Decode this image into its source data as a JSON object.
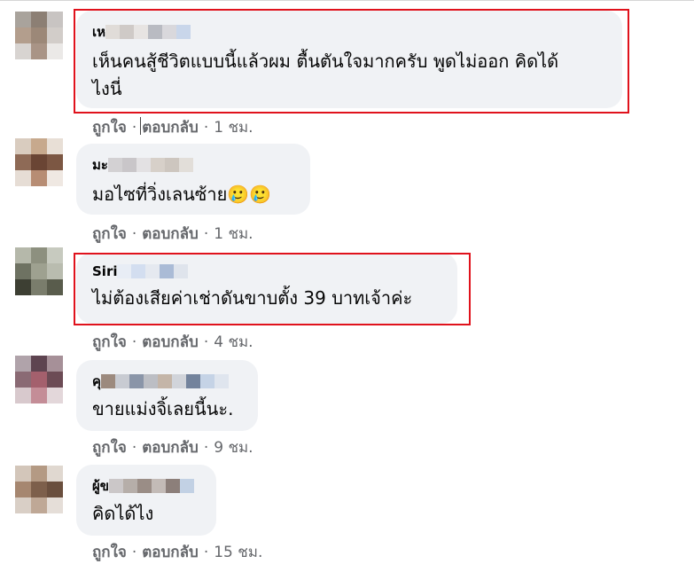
{
  "comments": [
    {
      "author": "เห",
      "text": "เห็นคนสู้ชีวิตแบบนี้แล้วผม ตื้นตันใจมากครับ พูดไม่ออก คิดได้\nไงนี่",
      "like_label": "ถูกใจ",
      "reply_label": "ตอบกลับ",
      "time": "1 ชม.",
      "highlighted": true
    },
    {
      "author": "มะ",
      "text": "มอไซที่วิ่งเลนซ้าย🥲🥲",
      "like_label": "ถูกใจ",
      "reply_label": "ตอบกลับ",
      "time": "1 ชม.",
      "highlighted": false
    },
    {
      "author": "Siri",
      "text": "ไม่ต้องเสียค่าเช่าดันขาบตั้ง 39 บาทเจ้าค่ะ",
      "like_label": "ถูกใจ",
      "reply_label": "ตอบกลับ",
      "time": "4 ชม.",
      "highlighted": true
    },
    {
      "author": "คุ",
      "text": "ขายแม่งจิ้เลยนี้นะ.",
      "like_label": "ถูกใจ",
      "reply_label": "ตอบกลับ",
      "time": "9 ชม.",
      "highlighted": false
    },
    {
      "author": "ผู้ข",
      "text": "คิดได้ไง",
      "like_label": "ถูกใจ",
      "reply_label": "ตอบกลับ",
      "time": "15 ชม.",
      "highlighted": false
    }
  ],
  "colors": {
    "bubble": "#f0f2f5",
    "highlight_border": "#e0121c",
    "meta_text": "#65676b"
  }
}
